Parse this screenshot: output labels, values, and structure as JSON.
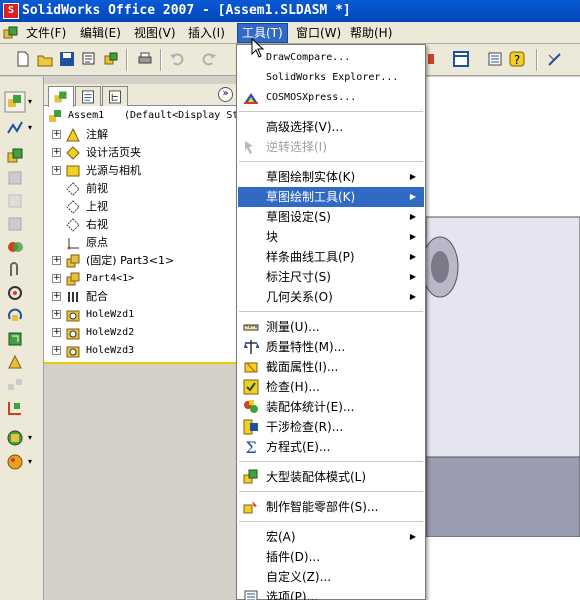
{
  "window": {
    "title": "SolidWorks Office 2007 - [Assem1.SLDASM *]",
    "app_icon": "solidworks-logo-icon"
  },
  "menubar": {
    "items": [
      {
        "label": "文件(F)"
      },
      {
        "label": "编辑(E)"
      },
      {
        "label": "视图(V)"
      },
      {
        "label": "插入(I)"
      },
      {
        "label": "工具(T)"
      },
      {
        "label": "窗口(W)"
      },
      {
        "label": "帮助(H)"
      }
    ]
  },
  "toolbar": {
    "icons": [
      "new-document-icon",
      "open-folder-icon",
      "save-icon",
      "print-preview-icon",
      "rebuild-icon",
      "print-icon",
      "undo-icon",
      "redo-icon",
      "part-icon",
      "view-options-icon",
      "options-icon",
      "help-icon",
      "sketch-icon"
    ]
  },
  "feature_manager": {
    "tabs": [
      "featuremanager-tab",
      "propertymanager-tab",
      "configurationmanager-tab"
    ],
    "root": {
      "label": "Assem1",
      "config": "(Default<Display St"
    },
    "tree": [
      {
        "label": "注解",
        "icon": "annotations-icon"
      },
      {
        "label": "设计活页夹",
        "icon": "design-binder-icon"
      },
      {
        "label": "光源与相机",
        "icon": "lights-cameras-icon"
      },
      {
        "label": "前视",
        "icon": "plane-icon"
      },
      {
        "label": "上视",
        "icon": "plane-icon"
      },
      {
        "label": "右视",
        "icon": "plane-icon"
      },
      {
        "label": "原点",
        "icon": "origin-icon"
      },
      {
        "label": "(固定) Part3<1>",
        "icon": "part-icon"
      },
      {
        "label": "Part4<1>",
        "icon": "part-icon"
      },
      {
        "label": "配合",
        "icon": "mates-icon"
      },
      {
        "label": "HoleWzd1",
        "icon": "hole-wizard-icon"
      },
      {
        "label": "HoleWzd2",
        "icon": "hole-wizard-icon"
      },
      {
        "label": "HoleWzd3",
        "icon": "hole-wizard-icon"
      }
    ]
  },
  "tools_menu": {
    "items": [
      {
        "label": "DrawCompare...",
        "type": "item"
      },
      {
        "label": "SolidWorks Explorer...",
        "type": "item"
      },
      {
        "label": "COSMOSXpress...",
        "type": "item",
        "icon": "cosmosxpress-icon"
      },
      {
        "type": "sep"
      },
      {
        "label": "高级选择(V)...",
        "type": "item"
      },
      {
        "label": "逆转选择(I)",
        "type": "disabled",
        "icon": "invert-selection-icon"
      },
      {
        "type": "sep"
      },
      {
        "label": "草图绘制实体(K)",
        "type": "submenu"
      },
      {
        "label": "草图绘制工具(K)",
        "type": "submenu",
        "highlighted": true
      },
      {
        "label": "草图设定(S)",
        "type": "submenu"
      },
      {
        "label": "块",
        "type": "submenu"
      },
      {
        "label": "样条曲线工具(P)",
        "type": "submenu"
      },
      {
        "label": "标注尺寸(S)",
        "type": "submenu"
      },
      {
        "label": "几何关系(O)",
        "type": "submenu"
      },
      {
        "type": "sep"
      },
      {
        "label": "测量(U)...",
        "type": "item",
        "icon": "measure-icon"
      },
      {
        "label": "质量特性(M)...",
        "type": "item",
        "icon": "mass-properties-icon"
      },
      {
        "label": "截面属性(I)...",
        "type": "item",
        "icon": "section-properties-icon"
      },
      {
        "label": "检查(H)...",
        "type": "item",
        "icon": "check-icon"
      },
      {
        "label": "装配体统计(E)...",
        "type": "item",
        "icon": "assembly-statistics-icon"
      },
      {
        "label": "干涉检查(R)...",
        "type": "item",
        "icon": "interference-detection-icon"
      },
      {
        "label": "方程式(E)...",
        "type": "item",
        "icon": "equations-icon"
      },
      {
        "type": "sep"
      },
      {
        "label": "大型装配体模式(L)",
        "type": "item",
        "icon": "large-assembly-icon"
      },
      {
        "type": "sep"
      },
      {
        "label": "制作智能零部件(S)...",
        "type": "item",
        "icon": "smart-component-icon"
      },
      {
        "type": "sep"
      },
      {
        "label": "宏(A)",
        "type": "submenu"
      },
      {
        "label": "插件(D)...",
        "type": "item"
      },
      {
        "label": "自定义(Z)...",
        "type": "item"
      },
      {
        "label": "选项(P)...",
        "type": "item",
        "icon": "options-icon"
      }
    ]
  },
  "colors": {
    "title_bar": "#0a5ad6",
    "menu_highlight": "#316ac5",
    "part_face_front": "#e4e5f0",
    "part_face_side": "#9a9cb0",
    "part_face_top": "#cfd1e2"
  }
}
